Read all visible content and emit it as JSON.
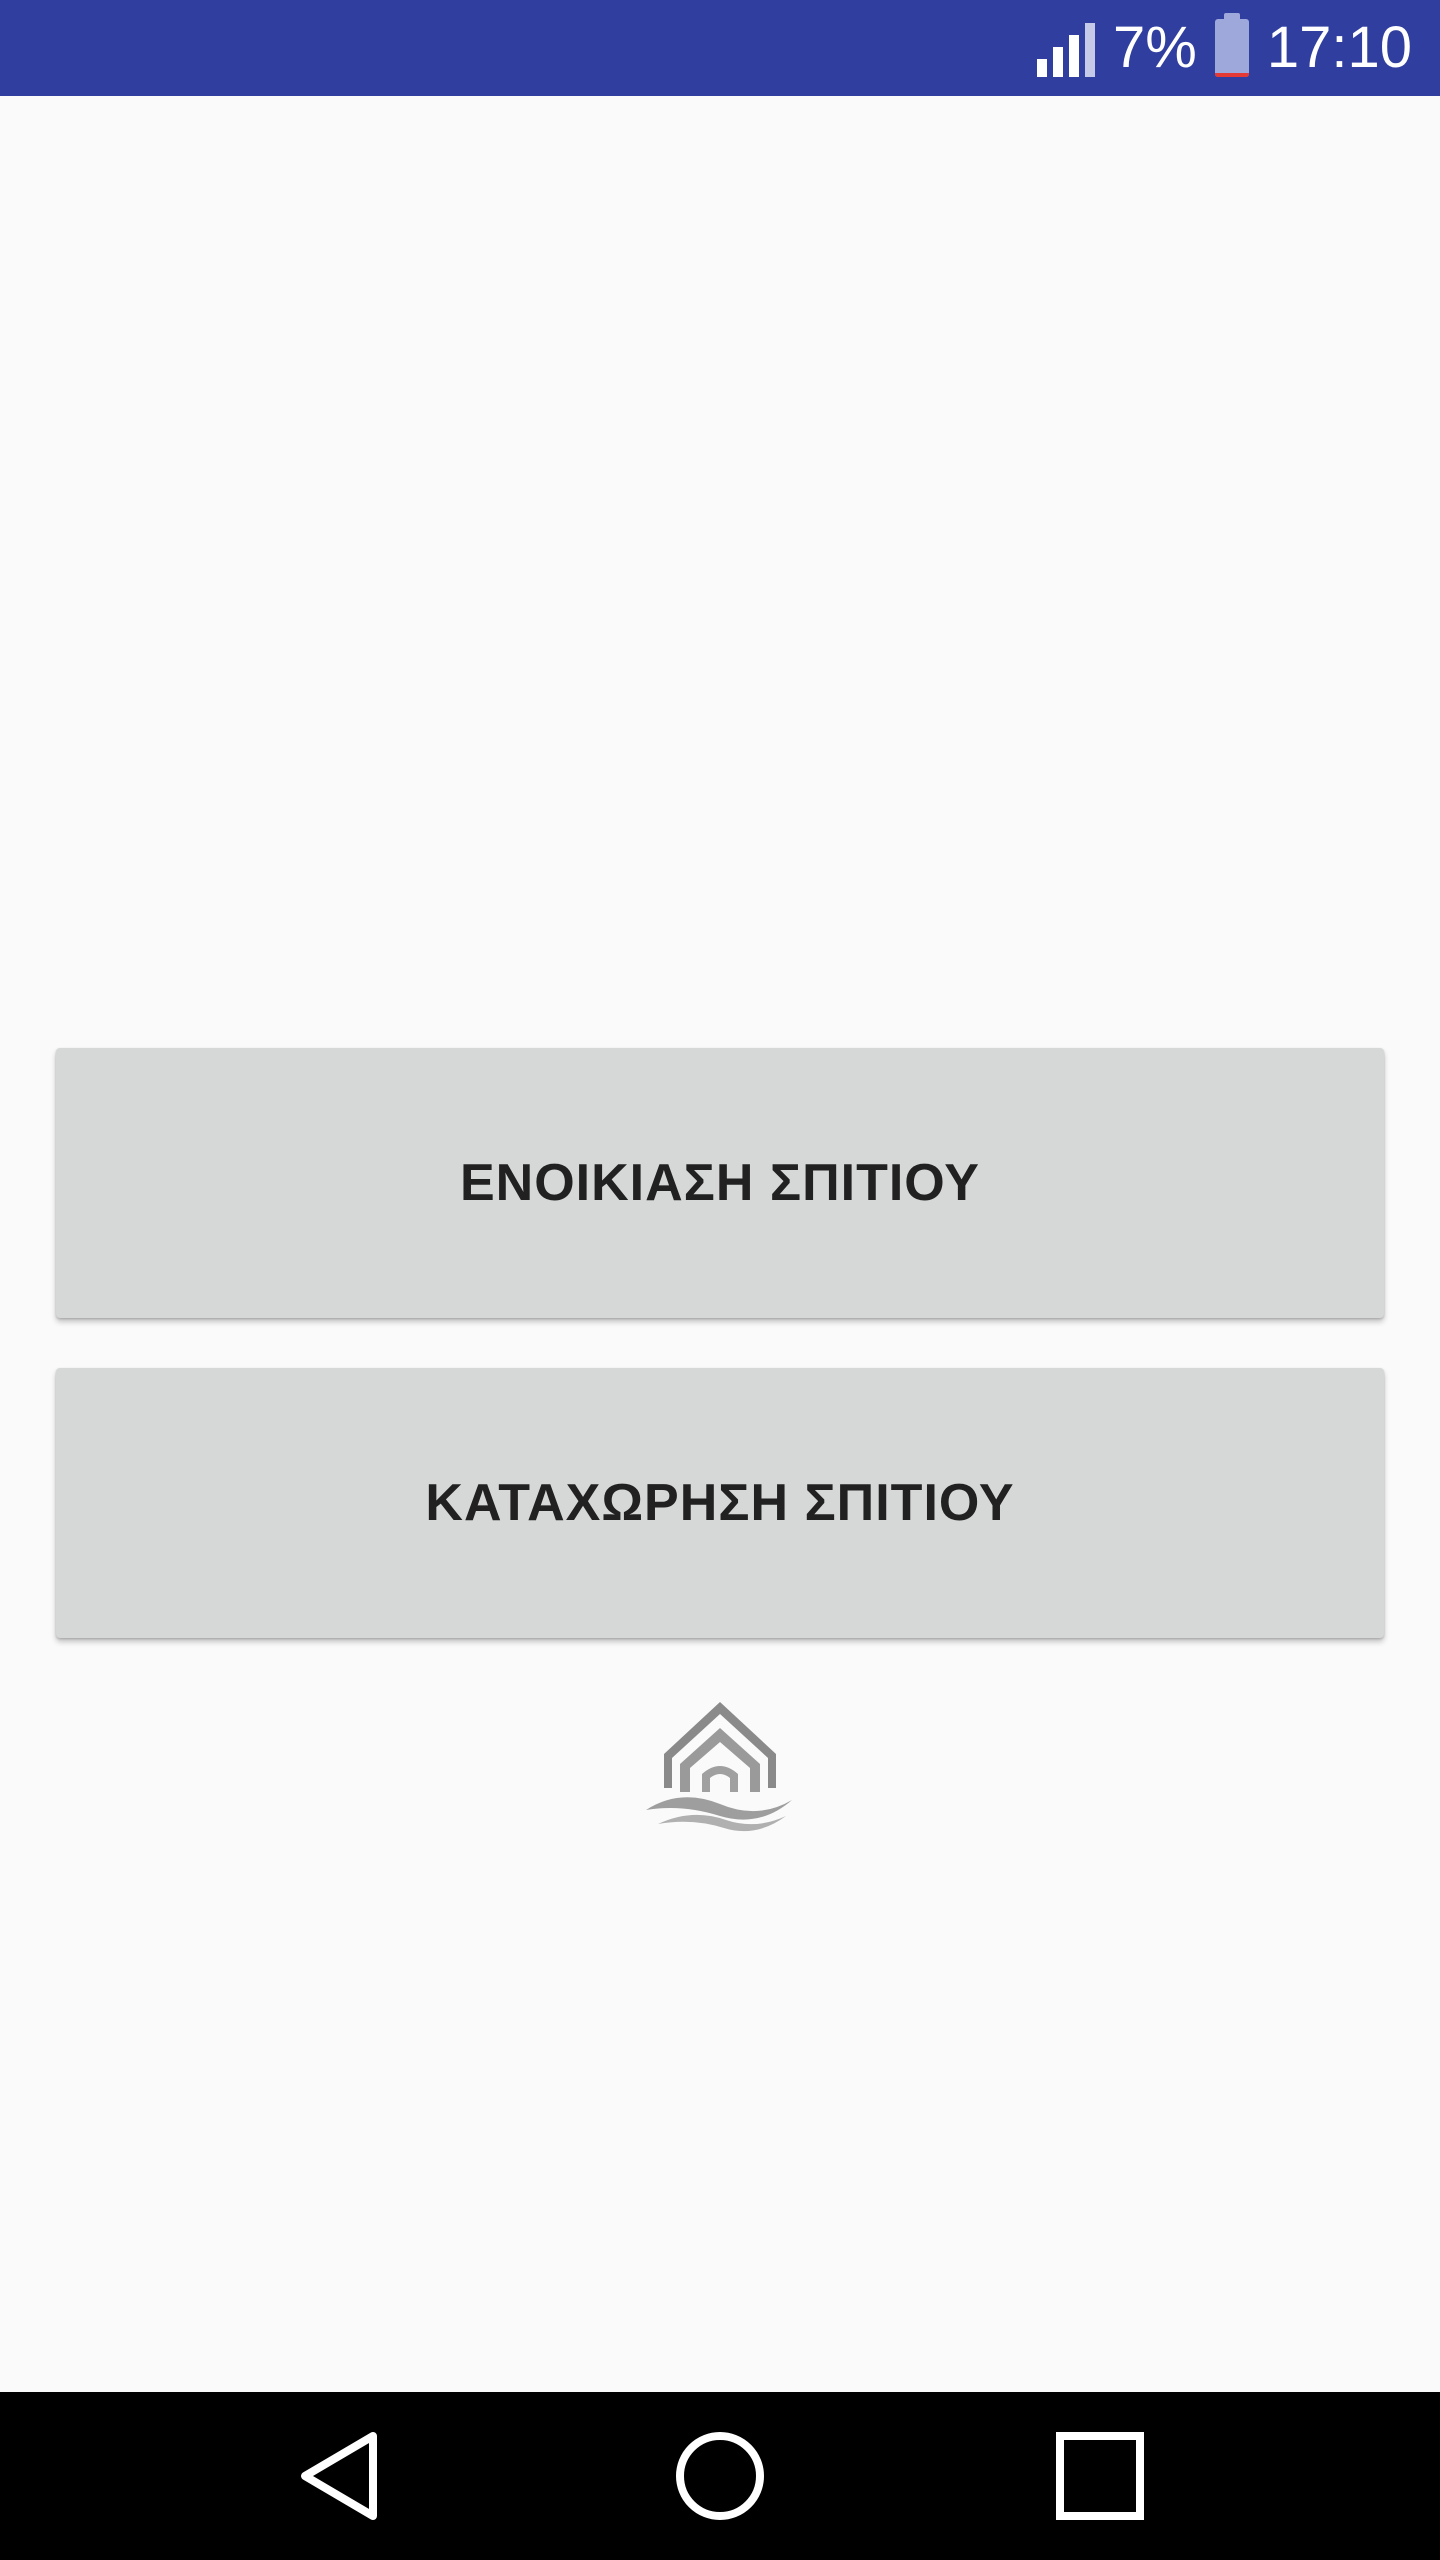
{
  "status_bar": {
    "battery_percent": "7%",
    "time": "17:10",
    "signal_icon": "signal-icon",
    "battery_icon": "battery-icon",
    "battery_level": 0.07,
    "background_color": "#303f9f"
  },
  "main": {
    "rent_button_label": "ΕΝΟΙΚΙΑΣΗ ΣΠΙΤΙΟΥ",
    "register_button_label": "ΚΑΤΑΧΩΡΗΣΗ ΣΠΙΤΙΟΥ",
    "button_color": "#d6d7d7",
    "logo_icon": "house-waves-logo-icon"
  },
  "nav_bar": {
    "back_icon": "back-triangle-icon",
    "home_icon": "home-circle-icon",
    "recents_icon": "recents-square-icon"
  }
}
